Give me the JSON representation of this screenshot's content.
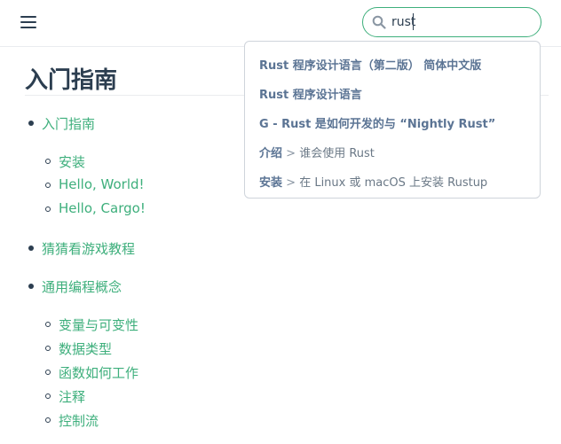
{
  "header": {
    "search": {
      "value": "rust",
      "placeholder": ""
    }
  },
  "page": {
    "title": "入门指南"
  },
  "toc": [
    {
      "label": "入门指南",
      "level": 1
    },
    {
      "label": "安装",
      "level": 2
    },
    {
      "label": "Hello, World!",
      "level": 2
    },
    {
      "label": "Hello, Cargo!",
      "level": 2
    },
    {
      "label": "猜猜看游戏教程",
      "level": 1
    },
    {
      "label": "通用编程概念",
      "level": 1
    },
    {
      "label": "变量与可变性",
      "level": 2
    },
    {
      "label": "数据类型",
      "level": 2
    },
    {
      "label": "函数如何工作",
      "level": 2
    },
    {
      "label": "注释",
      "level": 2
    },
    {
      "label": "控制流",
      "level": 2
    }
  ],
  "suggestions": [
    {
      "text": "Rust 程序设计语言（第二版） 简体中文版"
    },
    {
      "text": "Rust 程序设计语言"
    },
    {
      "text": "G - Rust 是如何开发的与 “Nightly Rust”"
    },
    {
      "page": "介绍",
      "sep": " > ",
      "sub": "谁会使用 Rust"
    },
    {
      "page": "安装",
      "sep": " > ",
      "sub": "在 Linux 或 macOS 上安装 Rustup"
    }
  ],
  "colors": {
    "accent": "#3eaf7c",
    "text": "#2c3e50",
    "suggestion": "#5b7494"
  }
}
